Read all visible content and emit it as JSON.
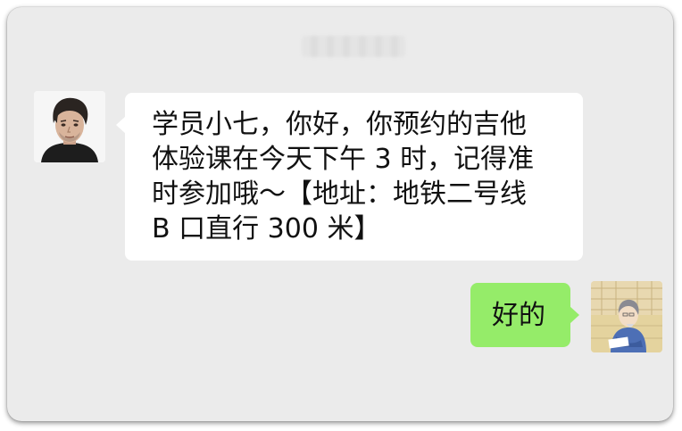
{
  "chat": {
    "timestamp": "",
    "colors": {
      "background": "#ebebeb",
      "incoming_bubble": "#ffffff",
      "outgoing_bubble": "#95ec69",
      "text": "#111111"
    },
    "messages": [
      {
        "direction": "incoming",
        "avatar": "man-portrait-avatar",
        "text": "学员小七，你好，你预约的吉他\n体验课在今天下午 3 时，记得准\n时参加哦～【地址：地铁二号线\nB 口直行 300 米】"
      },
      {
        "direction": "outgoing",
        "avatar": "cartoon-reader-avatar",
        "text": "好的"
      }
    ]
  }
}
